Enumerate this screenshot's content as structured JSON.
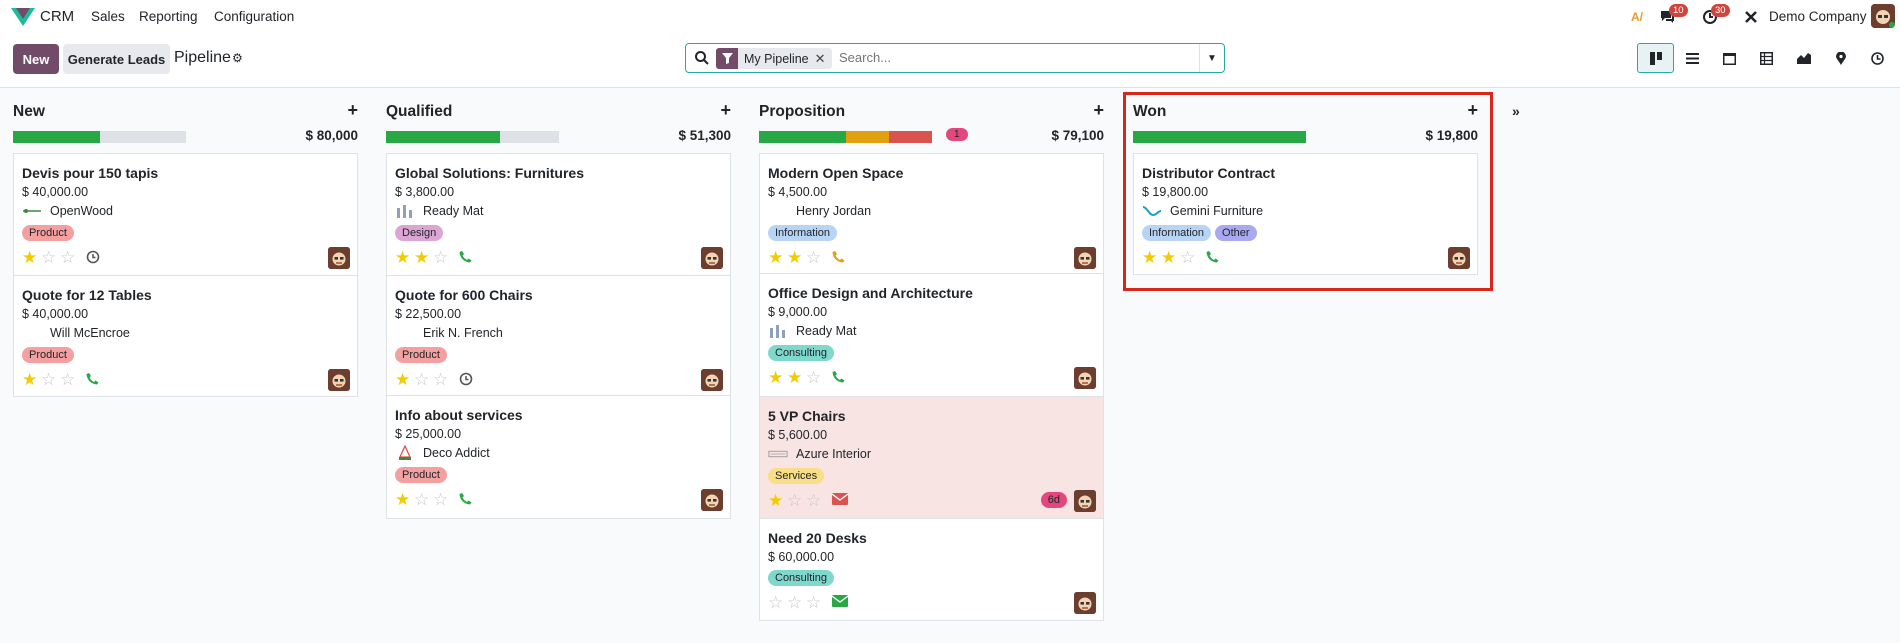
{
  "nav": {
    "app_name": "CRM",
    "menu": [
      "Sales",
      "Reporting",
      "Configuration"
    ],
    "messages_badge": "10",
    "activities_badge": "30",
    "company": "Demo Company"
  },
  "control": {
    "new_label": "New",
    "generate_label": "Generate Leads",
    "title": "Pipeline",
    "facet": "My Pipeline",
    "search_placeholder": "Search..."
  },
  "colors": {
    "primary": "#714b67",
    "accent": "#28a8a5",
    "green": "#28a745",
    "orange": "#e0a010",
    "red": "#d9534f"
  },
  "columns": [
    {
      "title": "New",
      "total": "$ 80,000",
      "progress": [
        {
          "color": "green",
          "pct": 50
        }
      ],
      "cards": [
        {
          "title": "Devis pour 150 tapis",
          "amount": "$ 40,000.00",
          "partner": "OpenWood",
          "tags": [
            "Product"
          ],
          "stars": 1,
          "activity": "clock"
        },
        {
          "title": "Quote for 12 Tables",
          "amount": "$ 40,000.00",
          "partner": "Will McEncroe",
          "tags": [
            "Product"
          ],
          "stars": 1,
          "activity": "phone"
        }
      ]
    },
    {
      "title": "Qualified",
      "total": "$ 51,300",
      "progress": [
        {
          "color": "green",
          "pct": 66
        }
      ],
      "cards": [
        {
          "title": "Global Solutions: Furnitures",
          "amount": "$ 3,800.00",
          "partner": "Ready Mat",
          "tags": [
            "Design"
          ],
          "stars": 2,
          "activity": "phone"
        },
        {
          "title": "Quote for 600 Chairs",
          "amount": "$ 22,500.00",
          "partner": "Erik N. French",
          "tags": [
            "Product"
          ],
          "stars": 1,
          "activity": "clock"
        },
        {
          "title": "Info about services",
          "amount": "$ 25,000.00",
          "partner": "Deco Addict",
          "tags": [
            "Product"
          ],
          "stars": 1,
          "activity": "phone"
        }
      ]
    },
    {
      "title": "Proposition",
      "total": "$ 79,100",
      "count": "1",
      "progress": [
        {
          "color": "green",
          "pct": 50
        },
        {
          "color": "orange",
          "pct": 25
        },
        {
          "color": "red",
          "pct": 25
        }
      ],
      "cards": [
        {
          "title": "Modern Open Space",
          "amount": "$ 4,500.00",
          "partner": "Henry Jordan",
          "tags": [
            "Information"
          ],
          "stars": 2,
          "activity": "phone-orange"
        },
        {
          "title": "Office Design and Architecture",
          "amount": "$ 9,000.00",
          "partner": "Ready Mat",
          "tags": [
            "Consulting"
          ],
          "stars": 2,
          "activity": "phone"
        },
        {
          "title": "5 VP Chairs",
          "amount": "$ 5,600.00",
          "partner": "Azure Interior",
          "tags": [
            "Services"
          ],
          "stars": 1,
          "activity": "mail-red",
          "late": "6d"
        },
        {
          "title": "Need 20 Desks",
          "amount": "$ 60,000.00",
          "partner": "",
          "tags": [
            "Consulting"
          ],
          "stars": 0,
          "activity": "mail-green"
        }
      ]
    },
    {
      "title": "Won",
      "total": "$ 19,800",
      "progress": [
        {
          "color": "green",
          "pct": 100
        }
      ],
      "cards": [
        {
          "title": "Distributor Contract",
          "amount": "$ 19,800.00",
          "partner": "Gemini Furniture",
          "tags": [
            "Information",
            "Other"
          ],
          "stars": 2,
          "activity": "phone"
        }
      ]
    }
  ]
}
